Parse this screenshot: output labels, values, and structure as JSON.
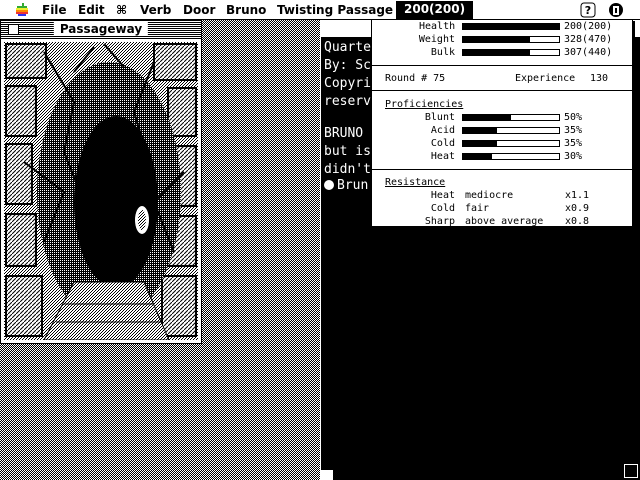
{
  "menubar": {
    "items": [
      "File",
      "Edit",
      "⌘",
      "Verb",
      "Door",
      "Bruno",
      "Twisting Passage"
    ],
    "active": "200(200)"
  },
  "window": {
    "title": "Passageway"
  },
  "text_window": {
    "lines": [
      "Quarte",
      "By: Sco",
      "Copyri",
      "reserv",
      "",
      "BRUNO",
      "but is t",
      "didn't c",
      "Brun"
    ]
  },
  "stats": {
    "health": {
      "label": "Health",
      "value_text": "200(200)",
      "fraction": 1.0
    },
    "weight": {
      "label": "Weight",
      "value_text": "328(470)",
      "fraction": 0.7
    },
    "bulk": {
      "label": "Bulk",
      "value_text": "307(440)",
      "fraction": 0.7
    },
    "round_label": "Round # 75",
    "experience_label": "Experience",
    "experience_value": "130"
  },
  "proficiencies": {
    "heading": "Proficiencies",
    "items": [
      {
        "label": "Blunt",
        "value_text": "50%",
        "fraction": 0.5
      },
      {
        "label": "Acid",
        "value_text": "35%",
        "fraction": 0.35
      },
      {
        "label": "Cold",
        "value_text": "35%",
        "fraction": 0.35
      },
      {
        "label": "Heat",
        "value_text": "30%",
        "fraction": 0.3
      }
    ]
  },
  "resistance": {
    "heading": "Resistance",
    "items": [
      {
        "type": "Heat",
        "level": "mediocre",
        "mult": "x1.1"
      },
      {
        "type": "Cold",
        "level": "fair",
        "mult": "x0.9"
      },
      {
        "type": "Sharp",
        "level": "above average",
        "mult": "x0.8"
      }
    ]
  }
}
